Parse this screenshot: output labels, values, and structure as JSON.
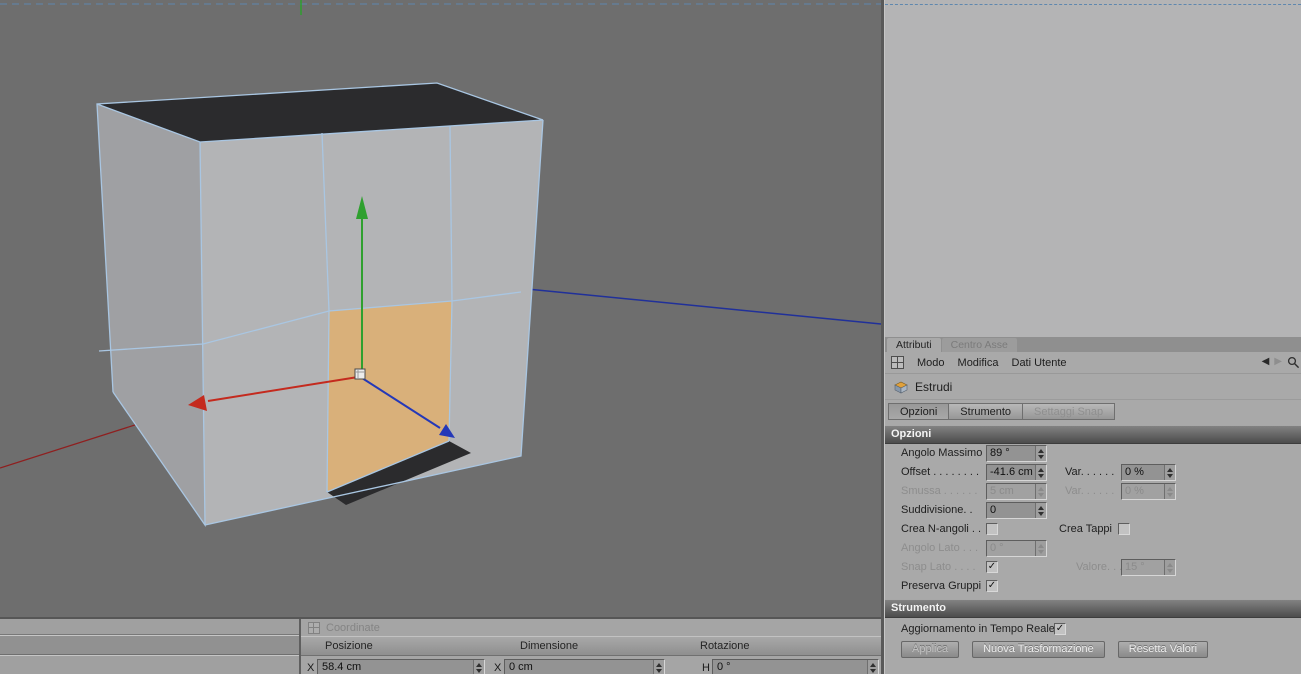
{
  "colors": {
    "axis_x_red": "#c42a1e",
    "axis_y_green": "#2fa02f",
    "axis_z_blue": "#2438b8",
    "selected_face": "#d9b07a",
    "wireframe_blue": "#a9c6e2",
    "viewport_bg": "#6e6e6e",
    "panel_bg": "#a9a9a9"
  },
  "icons": {
    "back_arrow": "◀",
    "forward_arrow": "▶"
  },
  "attribute_manager": {
    "tabs": [
      {
        "label": "Attributi",
        "active": true
      },
      {
        "label": "Centro Asse",
        "active": false
      }
    ],
    "menu_items": [
      "Modo",
      "Modifica",
      "Dati Utente"
    ],
    "tool_title": "Estrudi",
    "subtabs": [
      {
        "label": "Opzioni",
        "enabled": true
      },
      {
        "label": "Strumento",
        "enabled": true
      },
      {
        "label": "Settaggi Snap",
        "enabled": false
      }
    ],
    "opzioni_section": {
      "header": "Opzioni",
      "angolo_massimo": {
        "label": "Angolo Massimo",
        "value": "89 °"
      },
      "offset": {
        "label": "Offset . . . . . . . .",
        "value": "-41.6 cm"
      },
      "offset_var": {
        "label": "Var. . . . . .",
        "value": "0 %"
      },
      "smussa": {
        "label": "Smussa . . . . . .",
        "value": "5 cm",
        "enabled": false
      },
      "smussa_var": {
        "label": "Var. . . . . .",
        "value": "0 %",
        "enabled": false
      },
      "suddivisione": {
        "label": "Suddivisione. .",
        "value": "0"
      },
      "crea_nangoli": {
        "label": "Crea N-angoli . .",
        "checked": false
      },
      "crea_tappi": {
        "label": "Crea Tappi",
        "checked": false
      },
      "angolo_lato": {
        "label": "Angolo Lato . . .",
        "value": "0 °",
        "enabled": false
      },
      "snap_lato": {
        "label": "Snap Lato . . . .",
        "checked": true,
        "enabled": false
      },
      "valore": {
        "label": "Valore. . . .",
        "value": "15 °",
        "enabled": false
      },
      "preserva_gruppi": {
        "label": "Preserva Gruppi",
        "checked": true
      }
    },
    "strumento_section": {
      "header": "Strumento",
      "tempo_reale": {
        "label": "Aggiornamento in Tempo Reale",
        "checked": true
      },
      "buttons": {
        "applica": "Applica",
        "nuova_trasformazione": "Nuova Trasformazione",
        "resetta_valori": "Resetta Valori"
      }
    }
  },
  "coordinate_manager": {
    "title": "Coordinate",
    "columns": [
      "Posizione",
      "Dimensione",
      "Rotazione"
    ],
    "posizione_x": {
      "label": "X",
      "value": "58.4 cm"
    },
    "dimensione_x": {
      "label": "X",
      "value": "0 cm"
    },
    "rotazione_h": {
      "label": "H",
      "value": "0 °"
    }
  }
}
